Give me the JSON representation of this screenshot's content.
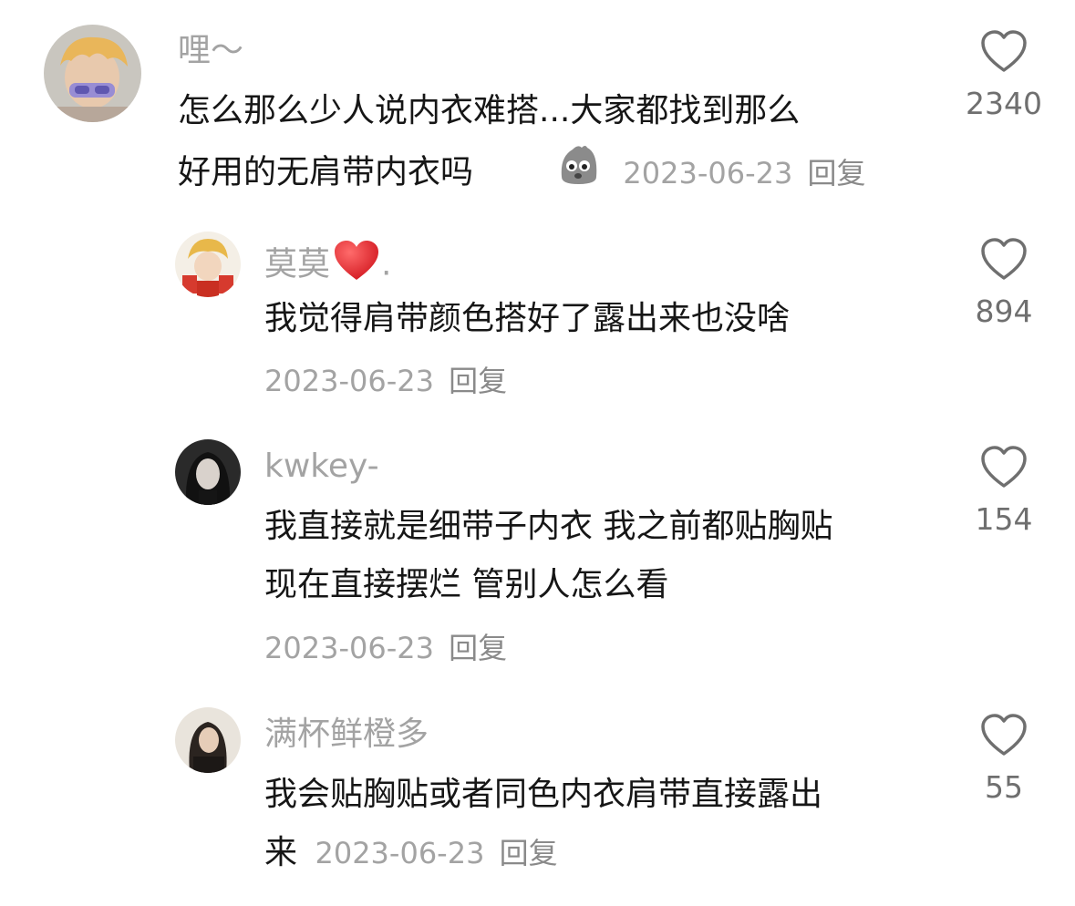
{
  "colors": {
    "username": "#a3a3a3",
    "body_text": "#161616",
    "meta": "#a3a3a3",
    "like_count": "#6f6f6f",
    "heart_emoji": "#e5242b"
  },
  "comments": [
    {
      "username": "哩～",
      "text_line1": "怎么那么少人说内衣难搭...大家都找到那么",
      "text_line2": "好用的无肩带内衣吗",
      "sticker": "sticker-icon",
      "date": "2023-06-23",
      "reply_label": "回复",
      "likes": "2340"
    },
    {
      "username": "莫莫",
      "username_suffix": ".",
      "username_emoji": "red-heart-icon",
      "text": "我觉得肩带颜色搭好了露出来也没啥",
      "date": "2023-06-23",
      "reply_label": "回复",
      "likes": "894"
    },
    {
      "username": "kwkey-",
      "text_line1": "我直接就是细带子内衣 我之前都贴胸贴",
      "text_line2": "现在直接摆烂 管别人怎么看",
      "date": "2023-06-23",
      "reply_label": "回复",
      "likes": "154"
    },
    {
      "username": "满杯鲜橙多",
      "text_line1": "我会贴胸贴或者同色内衣肩带直接露出",
      "text_line2": "来",
      "date": "2023-06-23",
      "reply_label": "回复",
      "likes": "55"
    }
  ]
}
